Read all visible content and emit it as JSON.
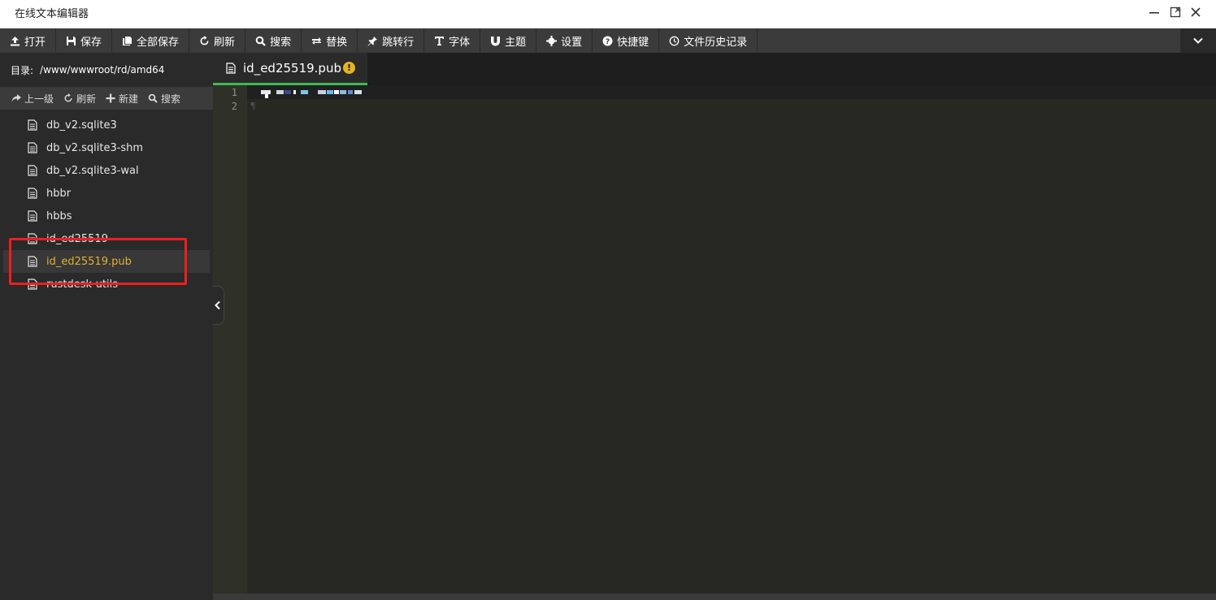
{
  "window": {
    "title": "在线文本编辑器"
  },
  "toolbar": {
    "items": [
      {
        "label": "打开",
        "icon": "upload-icon"
      },
      {
        "label": "保存",
        "icon": "save-icon"
      },
      {
        "label": "全部保存",
        "icon": "save-all-icon"
      },
      {
        "label": "刷新",
        "icon": "refresh-icon"
      },
      {
        "label": "搜索",
        "icon": "search-icon"
      },
      {
        "label": "替换",
        "icon": "replace-icon"
      },
      {
        "label": "跳转行",
        "icon": "pin-icon"
      },
      {
        "label": "字体",
        "icon": "font-icon"
      },
      {
        "label": "主题",
        "icon": "magnet-icon"
      },
      {
        "label": "设置",
        "icon": "gear-icon"
      },
      {
        "label": "快捷键",
        "icon": "help-icon"
      },
      {
        "label": "文件历史记录",
        "icon": "clock-icon"
      }
    ]
  },
  "sidebar": {
    "dir_label": "目录:",
    "dir_path": "/www/wwwroot/rd/amd64",
    "tools": {
      "up": "上一级",
      "refresh": "刷新",
      "new": "新建",
      "search": "搜索"
    },
    "files": [
      "db_v2.sqlite3",
      "db_v2.sqlite3-shm",
      "db_v2.sqlite3-wal",
      "hbbr",
      "hbbs",
      "id_ed25519",
      "id_ed25519.pub",
      "rustdesk-utils"
    ],
    "active_index": 6
  },
  "editor": {
    "tab_title": "id_ed25519.pub",
    "tab_warning": "!",
    "line_numbers": [
      "1",
      "2"
    ],
    "line2_marker": "¶"
  },
  "colors": {
    "accent_tab": "#3cba54",
    "active_file": "#e0b030",
    "highlight": "#ee1f1f",
    "warning": "#e5b421"
  }
}
